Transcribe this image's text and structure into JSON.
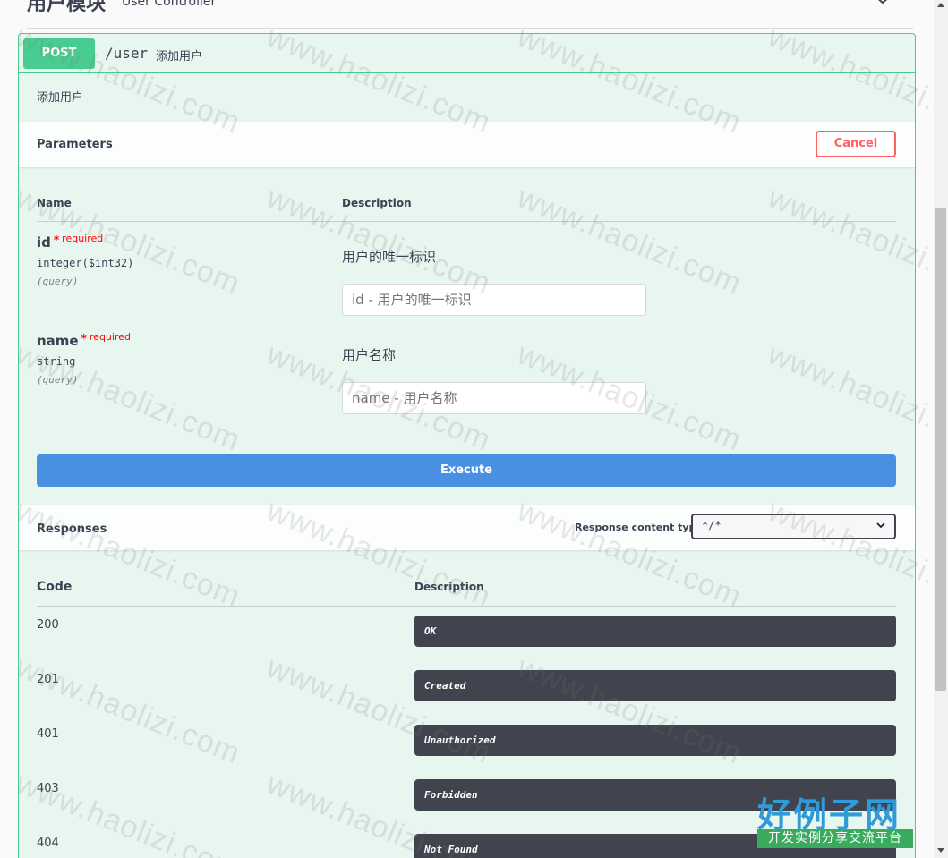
{
  "tag": {
    "title": "用户模块",
    "description": "User Controller"
  },
  "operation": {
    "method": "POST",
    "path": "/user",
    "summary": "添加用户",
    "description": "添加用户"
  },
  "parameters": {
    "title": "Parameters",
    "cancel_label": "Cancel",
    "col_name": "Name",
    "col_description": "Description",
    "required_star": "*",
    "required_label": "required",
    "items": [
      {
        "name": "id",
        "type": "integer($int32)",
        "in": "(query)",
        "description": "用户的唯一标识",
        "placeholder": "id - 用户的唯一标识"
      },
      {
        "name": "name",
        "type": "string",
        "in": "(query)",
        "description": "用户名称",
        "placeholder": "name - 用户名称"
      }
    ],
    "execute_label": "Execute"
  },
  "responses": {
    "title": "Responses",
    "content_type_label": "Response content type",
    "content_type_value": "*/*",
    "col_code": "Code",
    "col_description": "Description",
    "items": [
      {
        "code": "200",
        "description": "OK"
      },
      {
        "code": "201",
        "description": "Created"
      },
      {
        "code": "401",
        "description": "Unauthorized"
      },
      {
        "code": "403",
        "description": "Forbidden"
      },
      {
        "code": "404",
        "description": "Not Found"
      }
    ]
  },
  "watermark": {
    "text": "www.haolizi.com"
  },
  "logo": {
    "main": "好例子网",
    "sub": "开发实例分享交流平台"
  },
  "colors": {
    "post_green": "#49cc90",
    "op_bg": "#e8f6f0",
    "execute_blue": "#4990e2",
    "cancel_red": "#ff6060",
    "response_dark": "#41444e"
  }
}
